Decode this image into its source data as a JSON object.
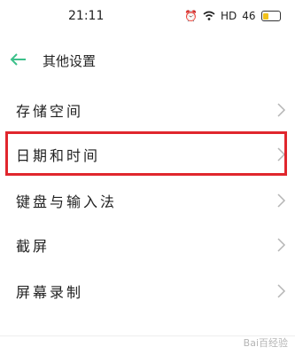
{
  "status_bar": {
    "time": "21:11",
    "icons": [
      "alarm-icon",
      "wifi-icon",
      "hd-signal-icon",
      "cellular-signal-icon",
      "battery-icon"
    ],
    "hd_label": "HD",
    "signal_label": "46",
    "battery_level": 0.4
  },
  "header": {
    "title": "其他设置",
    "back_icon": "arrow-left-icon",
    "accent_color": "#3cc08a"
  },
  "menu": {
    "items": [
      {
        "label": "存储空间"
      },
      {
        "label": "日期和时间"
      },
      {
        "label": "键盘与输入法"
      },
      {
        "label": "截屏"
      },
      {
        "label": "屏幕录制"
      }
    ]
  },
  "highlight": {
    "color": "#e0262d",
    "target": "日期和时间"
  },
  "watermark": "Bai百经验"
}
